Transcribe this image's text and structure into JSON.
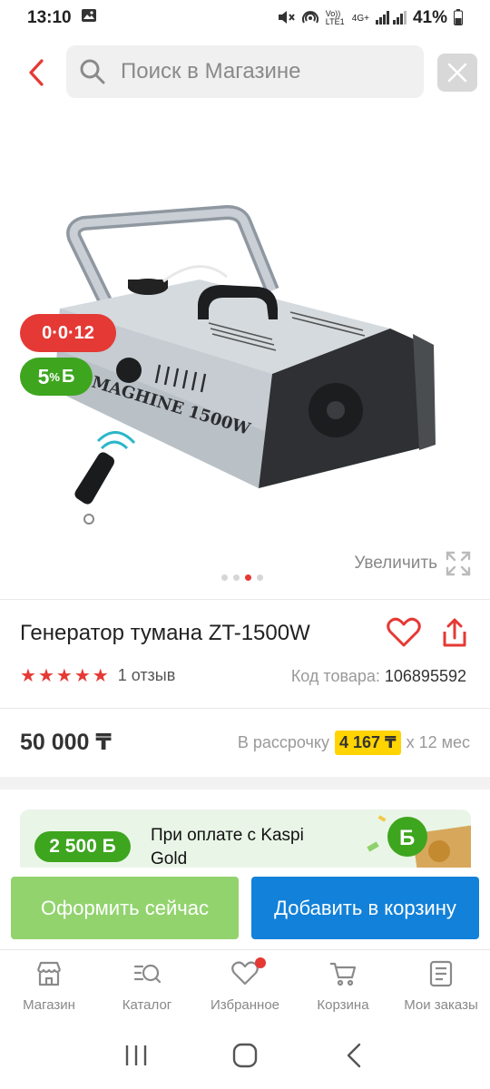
{
  "status_bar": {
    "time": "13:10",
    "network_label": "Vo)) LTE1",
    "network_type": "4G+",
    "battery": "41%"
  },
  "search": {
    "placeholder": "Поиск в Магазине"
  },
  "gallery": {
    "installment_badge": "0·0·12",
    "bonus_badge_value": "5",
    "bonus_badge_unit": "%",
    "bonus_badge_currency": "Б",
    "zoom_label": "Увеличить",
    "slide_count": 4,
    "active_slide": 3
  },
  "product": {
    "title": "Генератор тумана ZT-1500W",
    "rating_stars": 5,
    "reviews": "1 отзыв",
    "code_label": "Код товара:",
    "code_value": "106895592",
    "image_text": "MAGHINE 1500W"
  },
  "pricing": {
    "price": "50 000 ₸",
    "installment_prefix": "В рассрочку",
    "installment_amount": "4 167 ₸",
    "installment_suffix": "х 12 мес"
  },
  "promo": {
    "bonus_amount": "2 500 Б",
    "text": "При оплате с Kaspi Gold"
  },
  "actions": {
    "buy_now": "Оформить сейчас",
    "add_to_cart": "Добавить в корзину"
  },
  "nav": {
    "items": [
      {
        "label": "Магазин",
        "icon": "store-icon"
      },
      {
        "label": "Каталог",
        "icon": "catalog-search-icon"
      },
      {
        "label": "Избранное",
        "icon": "heart-icon"
      },
      {
        "label": "Корзина",
        "icon": "cart-icon"
      },
      {
        "label": "Мои заказы",
        "icon": "orders-icon"
      }
    ]
  },
  "colors": {
    "accent_red": "#e53935",
    "bonus_green": "#3ea51f",
    "buy_now_green": "#92d36e",
    "cart_blue": "#1281d9",
    "installment_yellow": "#ffd400"
  }
}
